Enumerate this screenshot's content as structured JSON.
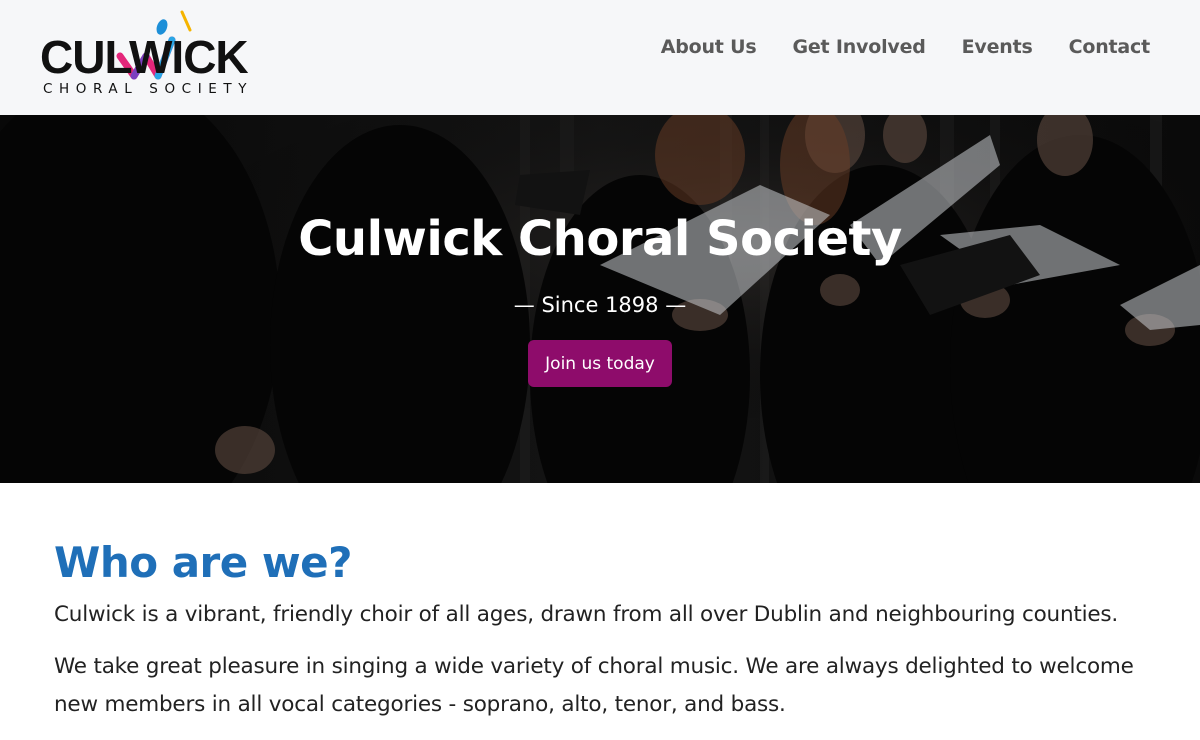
{
  "logo": {
    "wordmark": "CULWICK",
    "tagline": "CHORAL SOCIETY",
    "icon": "musical-baton-w-icon",
    "colors": [
      "#e4267a",
      "#7b3fbf",
      "#2aa6e6",
      "#f5b400"
    ]
  },
  "nav": {
    "items": [
      {
        "label": "About Us"
      },
      {
        "label": "Get Involved"
      },
      {
        "label": "Events"
      },
      {
        "label": "Contact"
      }
    ]
  },
  "hero": {
    "title": "Culwick Choral Society",
    "subtitle": "— Since 1898 —",
    "cta_label": "Join us today",
    "cta_color": "#8e0c6b"
  },
  "about": {
    "heading": "Who are we?",
    "heading_color": "#1f6fb8",
    "paragraphs": [
      "Culwick is a vibrant, friendly choir of all ages, drawn from all over Dublin and neighbouring counties.",
      "We take great pleasure in singing a wide variety of choral music. We are always delighted to welcome new members in all vocal categories - soprano, alto, tenor, and bass."
    ]
  }
}
